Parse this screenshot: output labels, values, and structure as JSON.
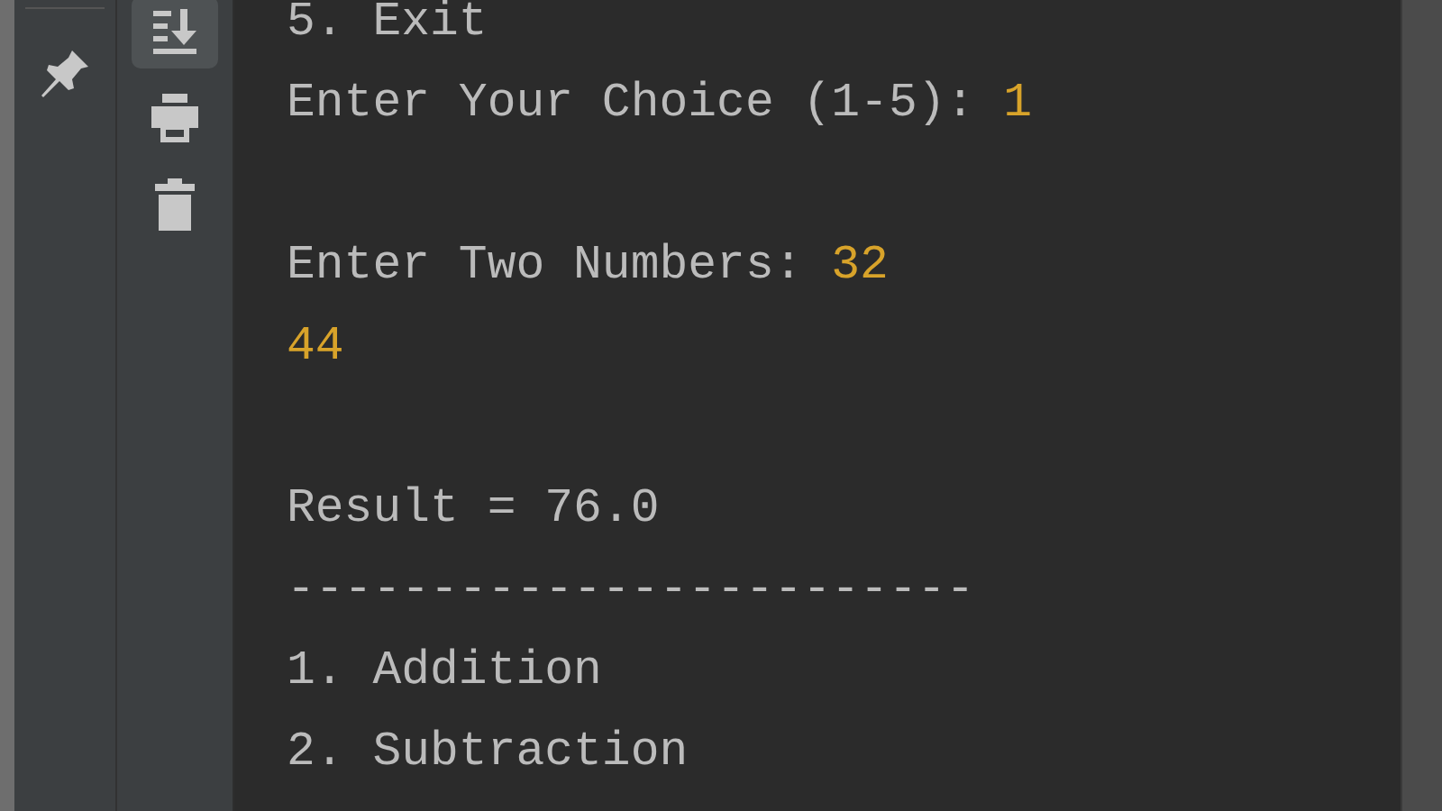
{
  "left_toolbar": [
    {
      "kind": "pin",
      "selected": false
    }
  ],
  "console_toolbar": [
    {
      "kind": "scroll-to-end",
      "selected": true
    },
    {
      "kind": "print",
      "selected": false
    },
    {
      "kind": "trash",
      "selected": false
    }
  ],
  "console": {
    "lines": [
      {
        "kind": "text",
        "text": "5. Exit"
      },
      {
        "kind": "text",
        "text": "Enter Your Choice (1-5): ",
        "input": "1"
      },
      {
        "kind": "blank"
      },
      {
        "kind": "text",
        "text": "Enter Two Numbers: ",
        "input": "32"
      },
      {
        "kind": "input",
        "input": "44"
      },
      {
        "kind": "blank"
      },
      {
        "kind": "text",
        "text": "Result = 76.0"
      },
      {
        "kind": "text",
        "text": "------------------------"
      },
      {
        "kind": "text",
        "text": "1. Addition"
      },
      {
        "kind": "text",
        "text": "2. Subtraction"
      }
    ]
  }
}
